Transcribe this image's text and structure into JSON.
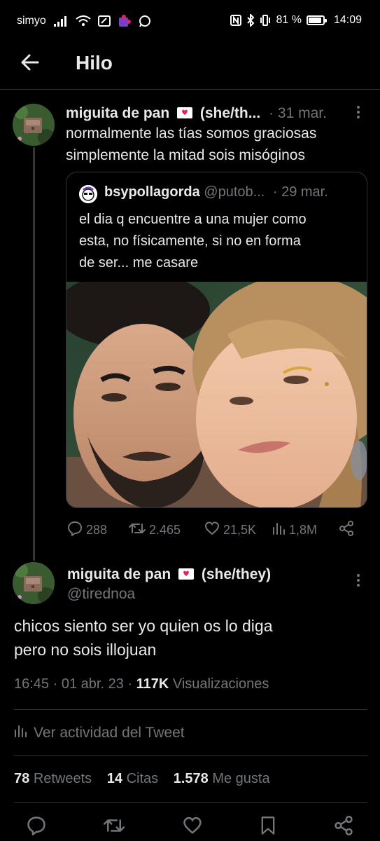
{
  "status_bar": {
    "carrier": "simyo",
    "battery_percent": "81 %",
    "battery_level": 0.81,
    "time": "14:09"
  },
  "header": {
    "title": "Hilo"
  },
  "parent_tweet": {
    "author_name": "miguita de pan",
    "author_suffix": "(she/th...",
    "date": "· 31 mar.",
    "text_lines": [
      "normalmente las tías somos graciosas",
      "simplemente la mitad sois misóginos"
    ],
    "quote": {
      "author_name": "bsypollagorda",
      "author_handle": "@putob...",
      "date": "· 29 mar.",
      "text_lines": [
        "el dia q encuentre a una mujer como",
        "esta, no físicamente, si no en forma",
        "de ser... me casare"
      ]
    },
    "actions": {
      "replies": "288",
      "retweets": "2.465",
      "likes": "21,5K",
      "views": "1,8M"
    }
  },
  "main_tweet": {
    "author_name": "miguita de pan",
    "author_suffix": "(she/they)",
    "author_handle": "@tirednoa",
    "text_lines": [
      "chicos siento ser yo quien os lo diga",
      "pero no sois illojuan"
    ],
    "time": "16:45",
    "date": "01 abr. 23",
    "views_count": "117K",
    "views_label": "Visualizaciones",
    "activity_label": "Ver actividad del Tweet",
    "retweets_count": "78",
    "retweets_label": "Retweets",
    "quotes_count": "14",
    "quotes_label": "Citas",
    "likes_count": "1.578",
    "likes_label": "Me gusta"
  },
  "colors": {
    "background": "#000000",
    "text": "#e7e9ea",
    "muted": "#71767b",
    "divider": "#2f3336",
    "heart_emoji": "#e0245e"
  }
}
